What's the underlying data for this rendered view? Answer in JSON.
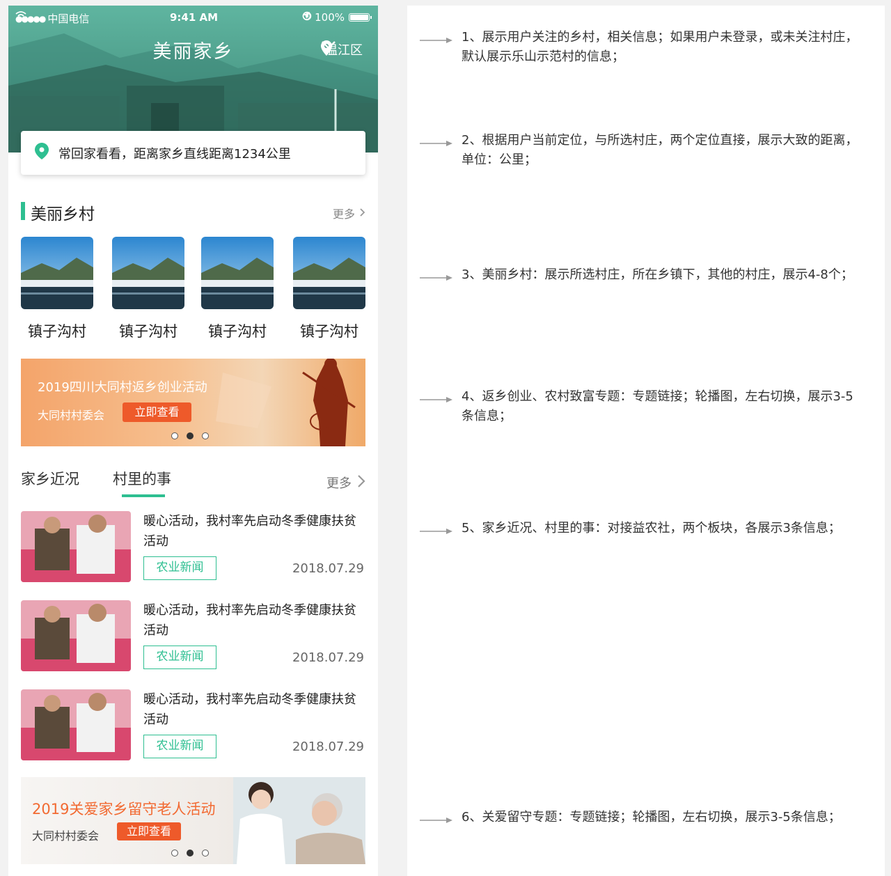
{
  "status_bar": {
    "carrier": "中国电信",
    "time": "9:41 AM",
    "battery": "100%"
  },
  "header": {
    "title": "美丽家乡",
    "location": "温江区"
  },
  "distance_card": {
    "text": "常回家看看，距离家乡直线距离1234公里"
  },
  "beautiful_village": {
    "title": "美丽乡村",
    "more": "更多",
    "items": [
      {
        "name": "镇子沟村"
      },
      {
        "name": "镇子沟村"
      },
      {
        "name": "镇子沟村"
      },
      {
        "name": "镇子沟村"
      }
    ]
  },
  "banner1": {
    "title": "2019四川大同村返乡创业活动",
    "subtitle": "大同村村委会",
    "button": "立即查看",
    "active_slide": 2,
    "slides": 3
  },
  "news_tabs": {
    "tab1": "家乡近况",
    "tab2": "村里的事",
    "more": "更多",
    "active_tab": 2
  },
  "news": [
    {
      "title": "暖心活动，我村率先启动冬季健康扶贫活动",
      "tag": "农业新闻",
      "date": "2018.07.29"
    },
    {
      "title": "暖心活动，我村率先启动冬季健康扶贫活动",
      "tag": "农业新闻",
      "date": "2018.07.29"
    },
    {
      "title": "暖心活动，我村率先启动冬季健康扶贫活动",
      "tag": "农业新闻",
      "date": "2018.07.29"
    }
  ],
  "banner2": {
    "title": "2019关爱家乡留守老人活动",
    "subtitle": "大同村村委会",
    "button": "立即查看",
    "active_slide": 2,
    "slides": 3
  },
  "notes": [
    "1、展示用户关注的乡村，相关信息；如果用户未登录，或未关注村庄，默认展示乐山示范村的信息；",
    "2、根据用户当前定位，与所选村庄，两个定位直接，展示大致的距离，单位：公里；",
    "3、美丽乡村：展示所选村庄，所在乡镇下，其他的村庄，展示4-8个；",
    "4、返乡创业、农村致富专题：专题链接；轮播图，左右切换，展示3-5条信息；",
    "5、家乡近况、村里的事：对接益农社，两个板块，各展示3条信息；",
    "6、关爱留守专题：专题链接；轮播图，左右切换，展示3-5条信息；"
  ],
  "colors": {
    "accent": "#2ebf91",
    "button_red": "#ee5a2a",
    "banner2_title": "#f26a32"
  }
}
